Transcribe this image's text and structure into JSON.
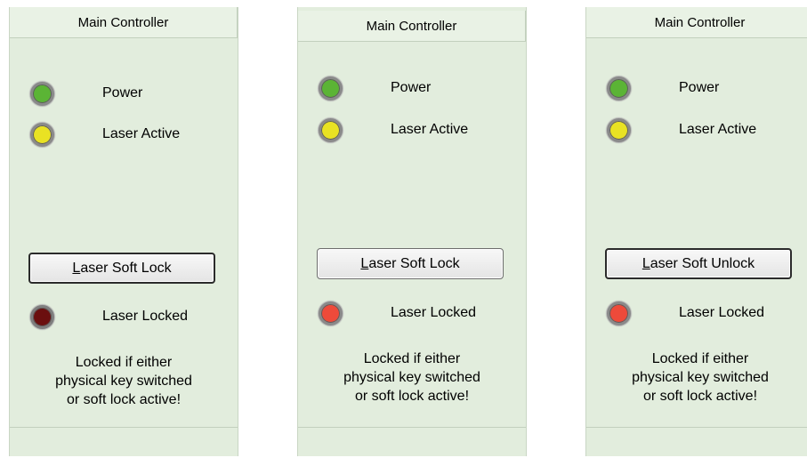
{
  "panels": [
    {
      "title": "Main Controller",
      "indicators": [
        {
          "label": "Power",
          "color": "#5bb435"
        },
        {
          "label": "Laser Active",
          "color": "#e9e223"
        }
      ],
      "button": {
        "mnemonic": "L",
        "rest": "aser Soft Lock"
      },
      "lock_indicator": {
        "label": "Laser Locked",
        "color": "#6b0f0f"
      },
      "note": [
        "Locked if either",
        "physical key switched",
        "or soft lock active!"
      ]
    },
    {
      "title": "Main Controller",
      "indicators": [
        {
          "label": "Power",
          "color": "#5bb435"
        },
        {
          "label": "Laser Active",
          "color": "#e9e223"
        }
      ],
      "button": {
        "mnemonic": "L",
        "rest": "aser Soft Lock"
      },
      "lock_indicator": {
        "label": "Laser Locked",
        "color": "#ee4a3a"
      },
      "note": [
        "Locked if either",
        "physical key switched",
        "or soft lock active!"
      ]
    },
    {
      "title": "Main Controller",
      "indicators": [
        {
          "label": "Power",
          "color": "#5bb435"
        },
        {
          "label": "Laser Active",
          "color": "#e9e223"
        }
      ],
      "button": {
        "mnemonic": "L",
        "rest": "aser Soft Unlock"
      },
      "lock_indicator": {
        "label": "Laser Locked",
        "color": "#ee4a3a"
      },
      "note": [
        "Locked if either",
        "physical key switched",
        "or soft lock active!"
      ]
    }
  ]
}
